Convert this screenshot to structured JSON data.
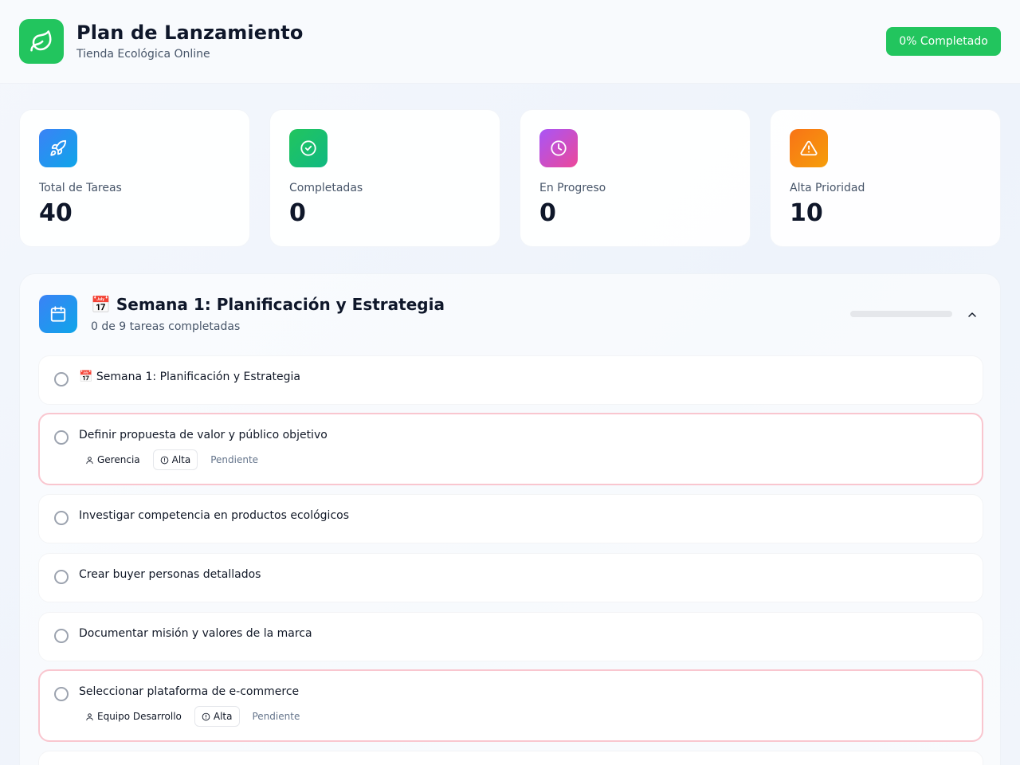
{
  "header": {
    "title": "Plan de Lanzamiento",
    "subtitle": "Tienda Ecológica Online",
    "progress_badge": "0% Completado",
    "logo_icon": "leaf-icon",
    "accent_color": "#22c55e"
  },
  "stats": [
    {
      "label": "Total de Tareas",
      "value": "40",
      "icon": "rocket-icon",
      "color": "#3b82f6"
    },
    {
      "label": "Completadas",
      "value": "0",
      "icon": "check-circle-icon",
      "color": "#22c55e"
    },
    {
      "label": "En Progreso",
      "value": "0",
      "icon": "clock-icon",
      "color": "#c026d3"
    },
    {
      "label": "Alta Prioridad",
      "value": "10",
      "icon": "alert-triangle-icon",
      "color": "#f97316"
    }
  ],
  "week": {
    "title": "📅 Semana 1: Planificación y Estrategia",
    "summary": "0 de 9 tareas completadas",
    "progress": 0,
    "icon": "calendar-icon",
    "collapse_icon": "chevron-up-icon"
  },
  "tasks": [
    {
      "text": "📅 Semana 1: Planificación y Estrategia"
    },
    {
      "text": "Definir propuesta de valor y público objetivo",
      "owner": "Gerencia",
      "priority": "Alta",
      "status": "Pendiente"
    },
    {
      "text": "Investigar competencia en productos ecológicos"
    },
    {
      "text": "Crear buyer personas detallados"
    },
    {
      "text": "Documentar misión y valores de la marca"
    },
    {
      "text": "Seleccionar plataforma de e-commerce",
      "owner": "Equipo Desarrollo",
      "priority": "Alta",
      "status": "Pendiente"
    }
  ]
}
